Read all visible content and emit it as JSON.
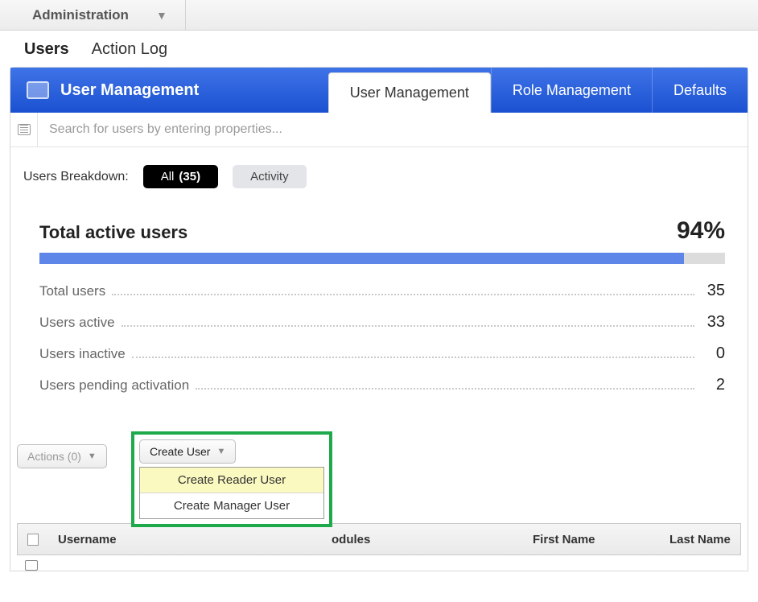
{
  "breadcrumb": {
    "label": "Administration"
  },
  "section_tabs": {
    "users": "Users",
    "action_log": "Action Log"
  },
  "header": {
    "title": "User Management",
    "tabs": {
      "user_mgmt": "User Management",
      "role_mgmt": "Role Management",
      "defaults": "Defaults"
    }
  },
  "search": {
    "placeholder": "Search for users by entering properties..."
  },
  "breakdown": {
    "label": "Users Breakdown:",
    "all_label": "All",
    "all_count": "(35)",
    "activity": "Activity"
  },
  "stats": {
    "heading": "Total active users",
    "percent": "94%",
    "bar_pct": 94,
    "rows": [
      {
        "label": "Total users",
        "value": "35"
      },
      {
        "label": "Users active",
        "value": "33"
      },
      {
        "label": "Users inactive",
        "value": "0"
      },
      {
        "label": "Users pending activation",
        "value": "2"
      }
    ]
  },
  "actions": {
    "actions_btn": "Actions (0)",
    "create_btn": "Create User",
    "menu": {
      "reader": "Create Reader User",
      "manager": "Create Manager User"
    }
  },
  "table": {
    "cols": {
      "username": "Username",
      "modules": "odules",
      "first": "First Name",
      "last": "Last Name"
    }
  }
}
